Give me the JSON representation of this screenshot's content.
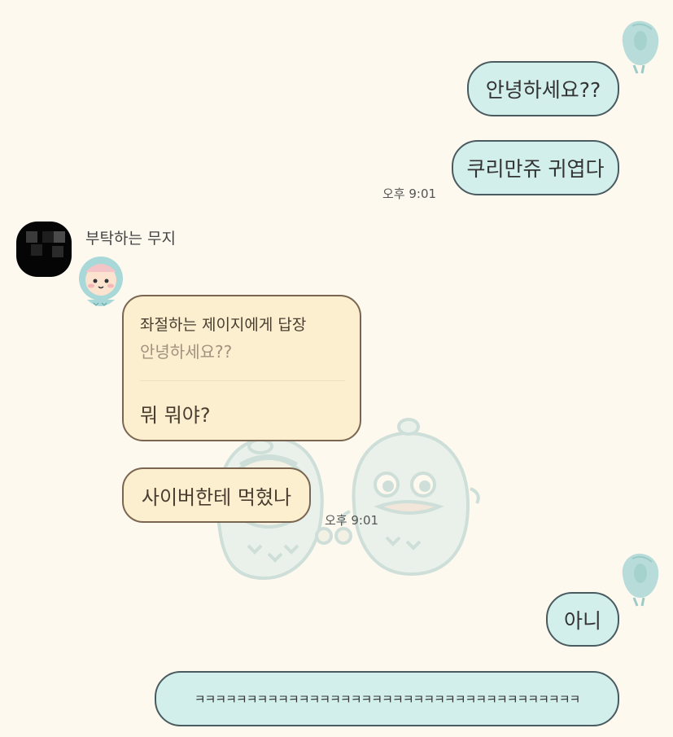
{
  "messages": {
    "m1": "안녕하세요??",
    "m2": "쿠리만쥬 귀엽다",
    "time1": "오후 9:01",
    "sender": "부탁하는 무지",
    "reply_header": "좌절하는 제이지에게 답장",
    "reply_quote": "안녕하세요??",
    "reply_text": "뭐 뭐야?",
    "m4": "사이버한테 먹혔나",
    "time2": "오후 9:01",
    "m5": "아니",
    "m6": "ㅋㅋㅋㅋㅋㅋㅋㅋㅋㅋㅋㅋㅋㅋㅋㅋㅋㅋㅋㅋㅋㅋㅋㅋㅋㅋㅋㅋㅋㅋㅋㅋㅋㅋㅋㅋㅋ"
  },
  "colors": {
    "background": "#fdf9ef",
    "mine_bubble": "#d2efec",
    "mine_border": "#4a5b60",
    "theirs_bubble": "#fbefcf",
    "theirs_border": "#7a6650"
  },
  "icons": {
    "my_profile": "blue-bird-profile-icon",
    "sender_avatar": "pixelated-black-avatar",
    "sticker": "pink-hooded-character-icon",
    "background_watermark": "ghost-and-duck-characters"
  }
}
